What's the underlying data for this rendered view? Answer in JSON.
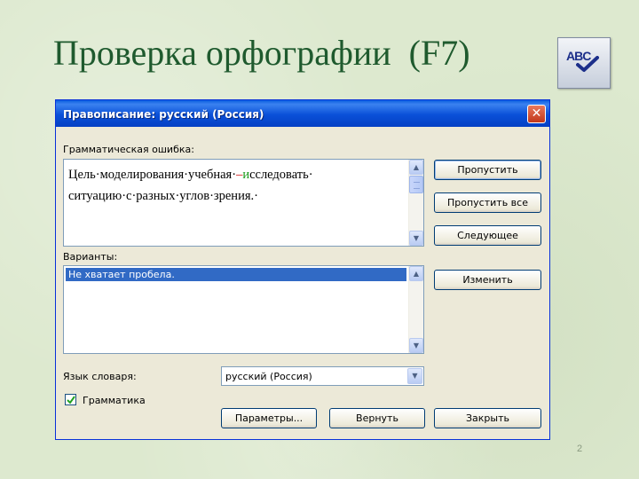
{
  "slide": {
    "title": "Проверка орфографии  (F7)",
    "page_number": "2"
  },
  "dialog": {
    "title": "Правописание: русский (Россия)",
    "close_glyph": "✕",
    "error_label": "Грамматическая ошибка:",
    "error_text": {
      "before": "Цель·моделирования·учебная·",
      "dash": "–",
      "highlight": "и",
      "after": "сследовать·",
      "line2": "ситуацию·с·разных·углов·зрения.·"
    },
    "suggestions_label": "Варианты:",
    "suggestions": [
      "Не хватает пробела."
    ],
    "dictionary_label": "Язык словаря:",
    "dictionary_value": "русский (Россия)",
    "grammar_label": "Грамматика",
    "grammar_checked": true,
    "buttons": {
      "skip": "Пропустить",
      "skip_all": "Пропустить все",
      "next": "Следующее",
      "change": "Изменить",
      "options": "Параметры...",
      "undo": "Вернуть",
      "close": "Закрыть"
    }
  },
  "icons": {
    "spellcheck_toolbar": "abc-check-icon",
    "abc_text": "ABC",
    "scroll_up": "▲",
    "scroll_down": "▼"
  },
  "colors": {
    "title_green": "#1f5a2e",
    "titlebar_blue": "#0a50d8",
    "selection_blue": "#316ac5",
    "error_dash_red": "#d00000",
    "error_highlight_green": "#1a9a1a"
  }
}
